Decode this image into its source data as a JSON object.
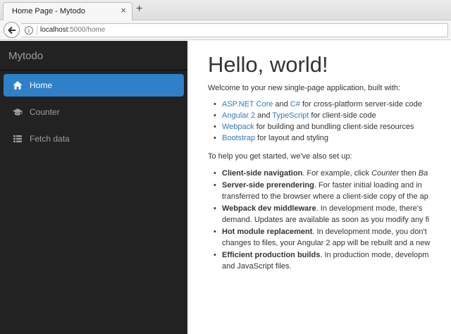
{
  "browser": {
    "tab_title": "Home Page - Mytodo",
    "tab_close": "×",
    "new_tab": "+",
    "url_host": "localhost",
    "url_path": ":5000/home"
  },
  "sidebar": {
    "brand": "Mytodo",
    "items": [
      {
        "label": "Home",
        "icon": "home-icon",
        "active": true
      },
      {
        "label": "Counter",
        "icon": "graduation-cap-icon",
        "active": false
      },
      {
        "label": "Fetch data",
        "icon": "list-icon",
        "active": false
      }
    ]
  },
  "main": {
    "heading": "Hello, world!",
    "intro": "Welcome to your new single-page application, built with:",
    "built_with": [
      {
        "parts": [
          "ASP.NET Core",
          " and ",
          "C#",
          " for cross-platform server-side code"
        ]
      },
      {
        "parts": [
          "Angular 2",
          " and ",
          "TypeScript",
          " for client-side code"
        ]
      },
      {
        "parts": [
          "Webpack",
          " for building and bundling client-side resources"
        ]
      },
      {
        "parts": [
          "Bootstrap",
          " for layout and styling"
        ]
      }
    ],
    "setup_intro": "To help you get started, we've also set up:",
    "setup": [
      {
        "title": "Client-side navigation",
        "line1": ". For example, click ",
        "em": "Counter",
        "line1b": " then ",
        "em2": "Ba",
        "line2": ""
      },
      {
        "title": "Server-side prerendering",
        "line1": ". For faster initial loading and in",
        "line2": "transferred to the browser where a client-side copy of the ap"
      },
      {
        "title": "Webpack dev middleware",
        "line1": ". In development mode, there's",
        "line2": "demand. Updates are available as soon as you modify any fi"
      },
      {
        "title": "Hot module replacement",
        "line1": ". In development mode, you don't",
        "line2": "changes to files, your Angular 2 app will be rebuilt and a new"
      },
      {
        "title": "Efficient production builds",
        "line1": ". In production mode, developm",
        "line2": "and JavaScript files."
      }
    ]
  },
  "colors": {
    "sidebar_bg": "#222222",
    "active_item": "#2e80c8",
    "link": "#337ab7"
  }
}
